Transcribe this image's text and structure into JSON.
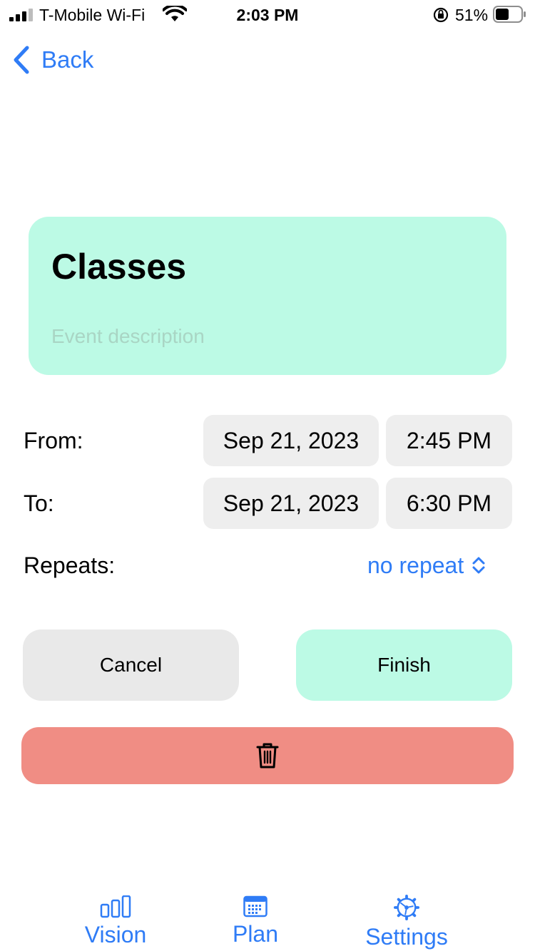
{
  "status_bar": {
    "carrier": "T-Mobile Wi-Fi",
    "time": "2:03 PM",
    "battery": "51%"
  },
  "nav": {
    "back_label": "Back"
  },
  "event": {
    "title": "Classes",
    "description_placeholder": "Event description"
  },
  "from": {
    "label": "From:",
    "date": "Sep 21, 2023",
    "time": "2:45 PM"
  },
  "to": {
    "label": "To:",
    "date": "Sep 21, 2023",
    "time": "6:30 PM"
  },
  "repeats": {
    "label": "Repeats:",
    "value": "no repeat"
  },
  "actions": {
    "cancel_label": "Cancel",
    "finish_label": "Finish",
    "delete_icon": "trash-icon"
  },
  "tabs": [
    {
      "label": "Vision",
      "icon": "bar-chart-icon"
    },
    {
      "label": "Plan",
      "icon": "calendar-icon"
    },
    {
      "label": "Settings",
      "icon": "gear-icon"
    }
  ],
  "colors": {
    "accent": "#2f7cf6",
    "card": "#bcfae5",
    "delete": "#f08d84",
    "pill": "#eeeeee"
  }
}
